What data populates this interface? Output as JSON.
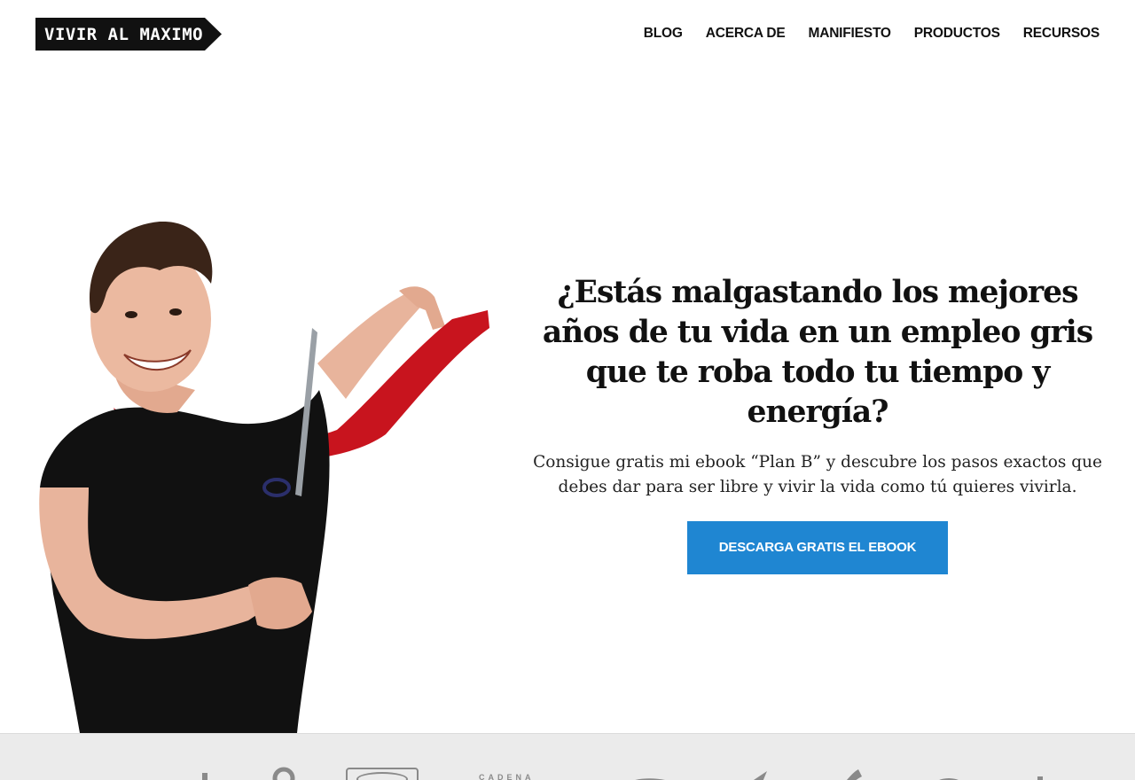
{
  "header": {
    "logo_text": "VIVIR AL MAXIMO",
    "nav": [
      {
        "label": "BLOG"
      },
      {
        "label": "ACERCA DE"
      },
      {
        "label": "MANIFIESTO"
      },
      {
        "label": "PRODUCTOS"
      },
      {
        "label": "RECURSOS"
      }
    ]
  },
  "hero": {
    "headline": "¿Estás malgastando los mejores años de tu vida en un empleo gris que te roba todo tu tiempo y energía?",
    "subtitle": "Consigue gratis mi ebook “Plan B” y descubre los pasos exactos que debes dar para ser libre y vivir la vida como tú quieres vivirla.",
    "cta_label": "DESCARGA GRATIS EL EBOOK"
  },
  "press": {
    "cadena_text": "CADENA"
  },
  "colors": {
    "accent": "#1f86d2",
    "logo_bg": "#111111",
    "tie": "#c8141e",
    "press_band": "#ebebeb"
  }
}
